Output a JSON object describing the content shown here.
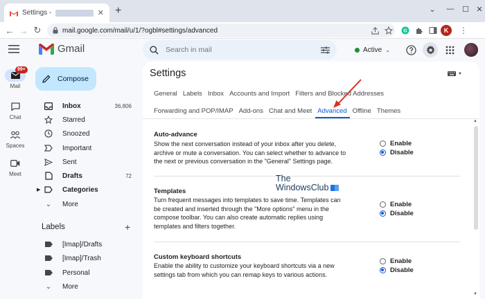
{
  "browser": {
    "tab_title": "Settings -",
    "tab_close": "✕",
    "new_tab": "+",
    "url": "mail.google.com/mail/u/1/?ogbl#settings/advanced",
    "profile_initial": "K",
    "window_controls": [
      "—",
      "☐",
      "✕"
    ]
  },
  "gmail": {
    "app_name": "Gmail",
    "search_placeholder": "Search in mail",
    "status": "Active",
    "status_color": "#1e8e3e"
  },
  "rail": {
    "mail_badge": "99+",
    "items": [
      {
        "label": "Mail",
        "icon": "mail-icon"
      },
      {
        "label": "Chat",
        "icon": "chat-icon"
      },
      {
        "label": "Spaces",
        "icon": "spaces-icon"
      },
      {
        "label": "Meet",
        "icon": "meet-icon"
      }
    ]
  },
  "compose_label": "Compose",
  "nav": {
    "inbox": {
      "label": "Inbox",
      "count": "36,806"
    },
    "starred": "Starred",
    "snoozed": "Snoozed",
    "important": "Important",
    "sent": "Sent",
    "drafts": {
      "label": "Drafts",
      "count": "72"
    },
    "categories": "Categories",
    "more": "More"
  },
  "labels": {
    "heading": "Labels",
    "add": "+",
    "items": [
      "[Imap]/Drafts",
      "[Imap]/Trash",
      "Personal"
    ],
    "more": "More"
  },
  "settings": {
    "title": "Settings",
    "tabs_row1": [
      "General",
      "Labels",
      "Inbox",
      "Accounts and Import",
      "Filters and Blocked Addresses"
    ],
    "tabs_row2": [
      "Forwarding and POP/IMAP",
      "Add-ons",
      "Chat and Meet",
      "Advanced",
      "Offline",
      "Themes"
    ],
    "active_tab": "Advanced",
    "accent": "#0b57d0",
    "sections": [
      {
        "title": "Auto-advance",
        "description": "Show the next conversation instead of your inbox after you delete, archive or mute a conversation. You can select whether to advance to the next or previous conversation in the \"General\" Settings page.",
        "options": [
          "Enable",
          "Disable"
        ],
        "selected": "Disable"
      },
      {
        "title": "Templates",
        "description": "Turn frequent messages into templates to save time. Templates can be created and inserted through the \"More options\" menu in the compose toolbar. You can also create automatic replies using templates and filters together.",
        "options": [
          "Enable",
          "Disable"
        ],
        "selected": "Disable"
      },
      {
        "title": "Custom keyboard shortcuts",
        "description": "Enable the ability to customize your keyboard shortcuts via a new settings tab from which you can remap keys to various actions.",
        "options": [
          "Enable",
          "Disable"
        ],
        "selected": "Disable"
      }
    ]
  },
  "watermark": {
    "line1": "The",
    "line2": "WindowsClub"
  }
}
